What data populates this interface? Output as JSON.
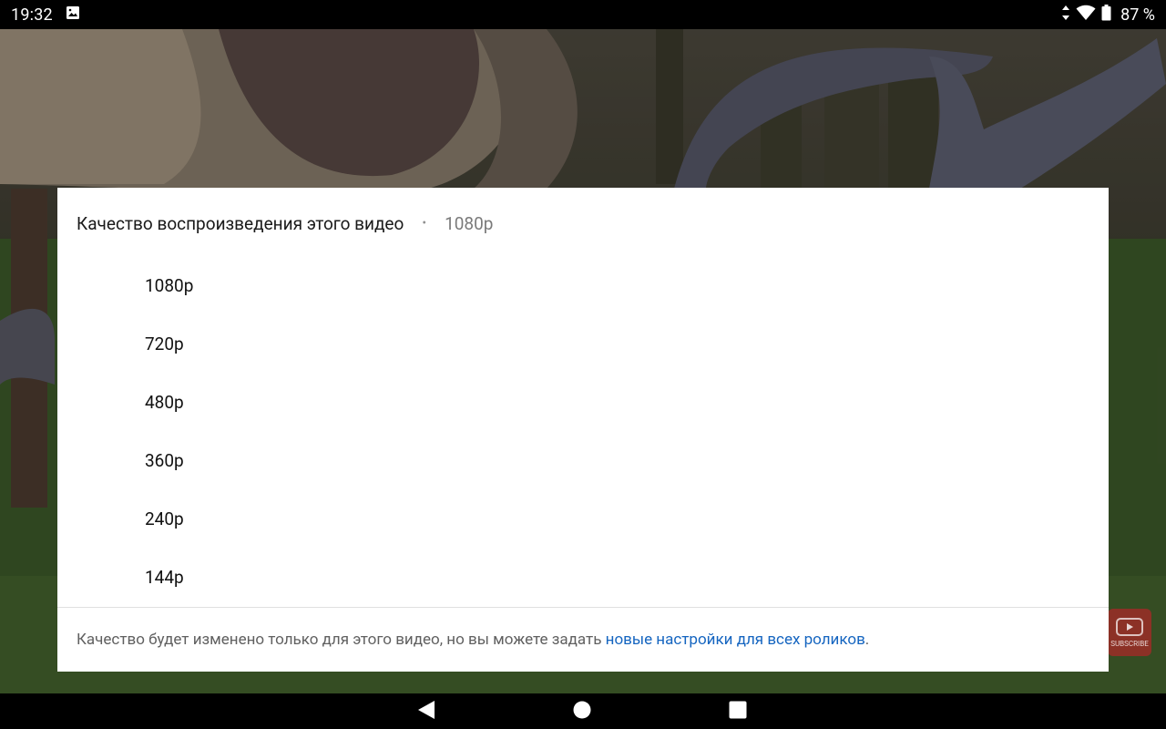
{
  "status_bar": {
    "time": "19:32",
    "battery": "87 %",
    "icons": [
      "image-icon",
      "data-arrows-icon",
      "wifi-icon",
      "battery-icon"
    ]
  },
  "dialog": {
    "title": "Качество воспроизведения этого видео",
    "separator": "•",
    "current_quality": "1080p",
    "options": [
      {
        "label": "1080p"
      },
      {
        "label": "720p"
      },
      {
        "label": "480p"
      },
      {
        "label": "360p"
      },
      {
        "label": "240p"
      },
      {
        "label": "144p"
      }
    ],
    "footer_text": "Качество будет изменено только для этого видео, но вы можете задать ",
    "footer_link": "новые настройки для всех роликов",
    "footer_end": "."
  },
  "watermark": {
    "label": "SUBSCRIBE"
  },
  "nav_bar": {
    "icons": [
      "back-icon",
      "home-icon",
      "recents-icon"
    ]
  },
  "colors": {
    "link": "#1565c0",
    "dialog_bg": "#ffffff",
    "status_bg": "#000000"
  }
}
